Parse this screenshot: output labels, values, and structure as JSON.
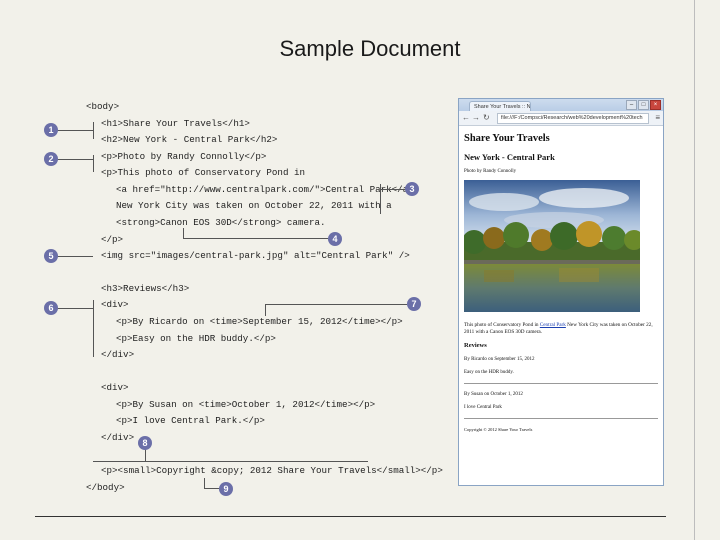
{
  "slide": {
    "title": "Sample Document"
  },
  "code_lines": [
    "<body>",
    "<h1>Share Your Travels</h1>",
    "<h2>New York - Central Park</h2>",
    "<p>Photo by Randy Connolly</p>",
    "<p>This photo of Conservatory Pond in",
    "<a href=\"http://www.centralpark.com/\">Central Park</a>",
    "New York City was taken on October 22, 2011 with a",
    "<strong>Canon EOS 30D</strong> camera.",
    "</p>",
    "<img src=\"images/central-park.jpg\" alt=\"Central Park\" />",
    "<h3>Reviews</h3>",
    "<div>",
    "<p>By Ricardo on <time>September 15, 2012</time></p>",
    "<p>Easy on the HDR buddy.</p>",
    "</div>",
    "<div>",
    "<p>By Susan on <time>October 1, 2012</time></p>",
    "<p>I love Central Park.</p>",
    "</div>",
    "<p><small>Copyright &copy; 2012 Share Your Travels</small></p>",
    "</body>"
  ],
  "callouts": [
    "1",
    "2",
    "3",
    "4",
    "5",
    "6",
    "7",
    "8",
    "9"
  ],
  "browser": {
    "tab_title": "Share Your Travels :: New",
    "address": "file:///F:/Compsci/Research/web%20development%20tech",
    "h1": "Share Your Travels",
    "h2": "New York - Central Park",
    "photo_by": "Photo by Randy Connolly",
    "para_before_link": "This photo of Conservatory Pond in ",
    "link_text": "Central Park",
    "para_after_link": " New York City was taken on October 22, 2011 with a Canon EOS 30D camera.",
    "reviews_heading": "Reviews",
    "review1_by": "By Ricardo on September 15, 2012",
    "review1_text": "Easy on the HDR buddy.",
    "review2_by": "By Susan on October 1, 2012",
    "review2_text": "I love Central Park",
    "copyright": "Copyright © 2012 Share Your Travels"
  }
}
